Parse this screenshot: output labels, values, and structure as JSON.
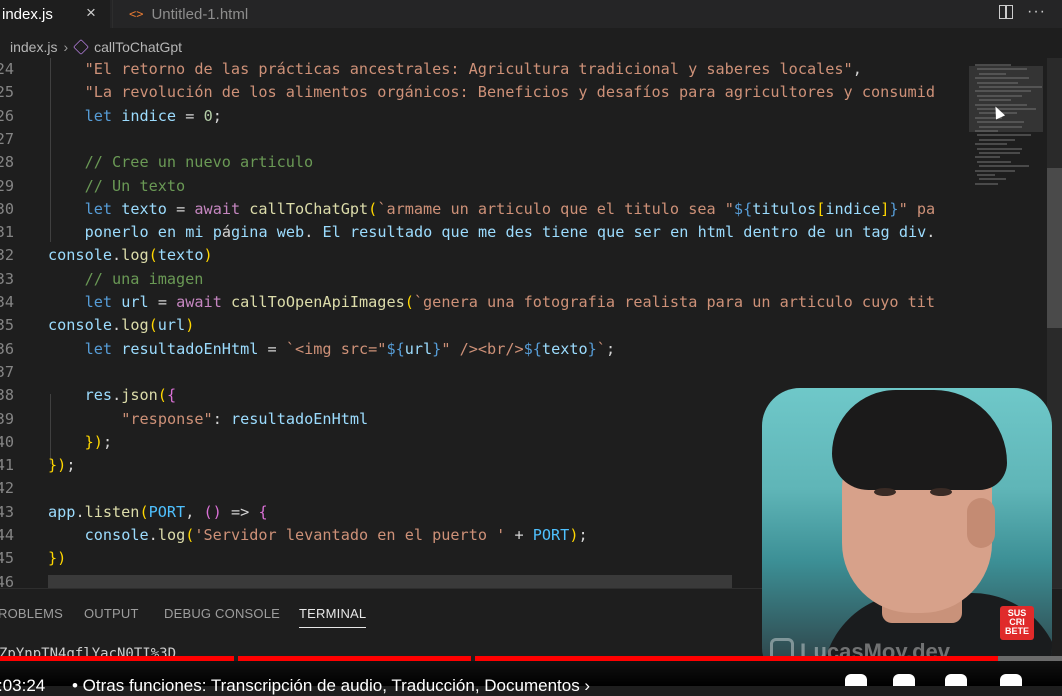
{
  "tabs": [
    {
      "title": "index.js",
      "active": true,
      "close": "×"
    },
    {
      "title": "Untitled-1.html",
      "active": false,
      "icon": "html-code-icon"
    }
  ],
  "breadcrumb": {
    "file": "index.js",
    "symbol": "callToChatGpt"
  },
  "editor": {
    "lines": [
      {
        "n": "24",
        "code": "    \"El retorno de las prácticas ancestrales: Agricultura tradicional y saberes locales\","
      },
      {
        "n": "25",
        "code": "    \"La revolución de los alimentos orgánicos: Beneficios y desafíos para agricultores y consumid"
      },
      {
        "n": "26",
        "code": "    let indice = 0;"
      },
      {
        "n": "27",
        "code": ""
      },
      {
        "n": "28",
        "code": "    // Cree un nuevo articulo"
      },
      {
        "n": "29",
        "code": "    // Un texto"
      },
      {
        "n": "30",
        "code": "    let texto = await callToChatGpt(`armame un articulo que el titulo sea \"${titulos[indice]}\" pa"
      },
      {
        "n": "31",
        "code": "    ponerlo en mi página web. El resultado que me des tiene que ser en html dentro de un tag div."
      },
      {
        "n": "32",
        "code": "console.log(texto)"
      },
      {
        "n": "33",
        "code": "    // una imagen"
      },
      {
        "n": "34",
        "code": "    let url = await callToOpenApiImages(`genera una fotografia realista para un articulo cuyo tit"
      },
      {
        "n": "35",
        "code": "console.log(url)"
      },
      {
        "n": "36",
        "code": "    let resultadoEnHtml = `<img src=\"${url}\" /><br/>${texto}`;"
      },
      {
        "n": "37",
        "code": ""
      },
      {
        "n": "38",
        "code": "    res.json({"
      },
      {
        "n": "39",
        "code": "        \"response\": resultadoEnHtml"
      },
      {
        "n": "40",
        "code": "    });"
      },
      {
        "n": "41",
        "code": "});"
      },
      {
        "n": "42",
        "code": ""
      },
      {
        "n": "43",
        "code": "app.listen(PORT, () => {"
      },
      {
        "n": "44",
        "code": "    console.log('Servidor levantado en el puerto ' + PORT);"
      },
      {
        "n": "45",
        "code": "})"
      },
      {
        "n": "46",
        "code": ""
      }
    ]
  },
  "panel": {
    "tabs": [
      "ROBLEMS",
      "OUTPUT",
      "DEBUG CONSOLE",
      "TERMINAL"
    ],
    "active_tab": "TERMINAL",
    "terminal_text": "ZpYnpTN4qflYacN0TI%3D"
  },
  "video": {
    "time": ":03:24",
    "chapter": "• Otras funciones: Transcripción de audio, Traducción, Documentos ›",
    "played_fraction": 0.94,
    "watermark": "LucasMoy.dev",
    "subscribe_badge": "SUS CRI BETE"
  },
  "colors": {
    "editor_bg": "#1e1e1e",
    "string": "#ce9178",
    "keyword": "#569cd6",
    "variable": "#9cdcfe",
    "function": "#dcdcaa",
    "comment": "#6a9955",
    "progress": "#ff0000"
  }
}
